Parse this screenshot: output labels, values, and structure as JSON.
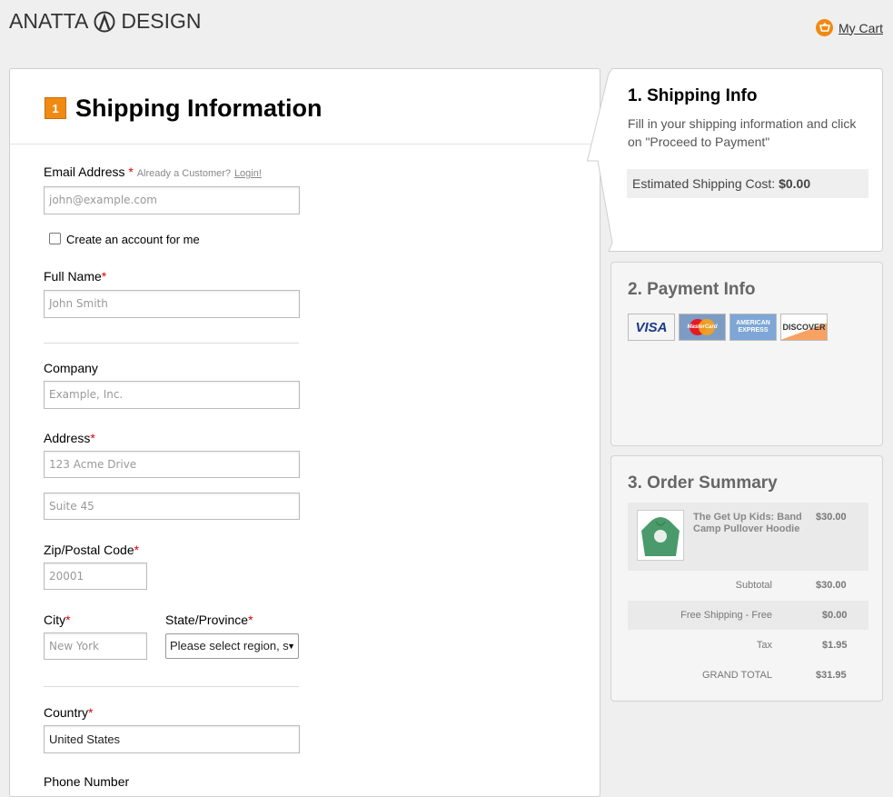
{
  "brand": {
    "left": "ANATTA",
    "right": "DESIGN"
  },
  "cart": {
    "label": "My Cart"
  },
  "shipping_form": {
    "step_number": "1",
    "title": "Shipping Information",
    "email": {
      "label": "Email Address",
      "note": "Already a Customer?",
      "login_link": "Login!",
      "placeholder": "john@example.com"
    },
    "create_account_label": "Create an account for me",
    "full_name": {
      "label": "Full Name",
      "placeholder": "John Smith"
    },
    "company": {
      "label": "Company",
      "placeholder": "Example, Inc."
    },
    "address": {
      "label": "Address",
      "line1_placeholder": "123 Acme Drive",
      "line2_placeholder": "Suite 45"
    },
    "zip": {
      "label": "Zip/Postal Code",
      "placeholder": "20001"
    },
    "city": {
      "label": "City",
      "placeholder": "New York"
    },
    "state": {
      "label": "State/Province",
      "value": "Please select region, s"
    },
    "country": {
      "label": "Country",
      "value": "United States"
    },
    "phone": {
      "label": "Phone Number"
    },
    "required_mark": "*"
  },
  "shipping_info": {
    "title": "1. Shipping Info",
    "description": "Fill in your shipping information and click on \"Proceed to Payment\"",
    "estimate_label": "Estimated Shipping Cost:",
    "estimate_value": "$0.00"
  },
  "payment_info": {
    "title": "2. Payment Info",
    "cards": [
      "VISA",
      "MasterCard",
      "AMERICAN EXPRESS",
      "DISCOVER"
    ]
  },
  "order_summary": {
    "title": "3. Order Summary",
    "item": {
      "name": "The Get Up Kids: Band Camp Pullover Hoodie",
      "price": "$30.00"
    },
    "rows": [
      {
        "label": "Subtotal",
        "value": "$30.00"
      },
      {
        "label": "Free Shipping - Free",
        "value": "$0.00"
      },
      {
        "label": "Tax",
        "value": "$1.95"
      },
      {
        "label": "GRAND TOTAL",
        "value": "$31.95"
      }
    ]
  },
  "colors": {
    "accent": "#f08a12",
    "required": "#dd0000"
  }
}
